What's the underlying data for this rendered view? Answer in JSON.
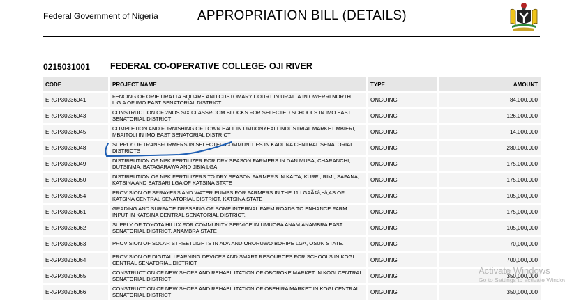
{
  "header": {
    "org": "Federal Government of Nigeria",
    "title": "APPROPRIATION BILL (DETAILS)"
  },
  "section": {
    "code": "0215031001",
    "name": "FEDERAL CO-OPERATIVE COLLEGE- OJI RIVER"
  },
  "table": {
    "columns": {
      "code": "CODE",
      "project": "PROJECT NAME",
      "type": "TYPE",
      "amount": "AMOUNT"
    },
    "rows": [
      {
        "code": "ERGP30236041",
        "project": "FENCING OF ORIE URATTA SQUARE AND CUSTOMARY COURT IN URATTA IN OWERRI NORTH L.G.A OF IMO EAST SENATORIAL DISTRICT",
        "type": "ONGOING",
        "amount": "84,000,000"
      },
      {
        "code": "ERGP30236043",
        "project": "CONSTRUCTION OF 2NOS SIX CLASSROOM BLOCKS FOR SELECTED SCHOOLS IN IMO EAST SENATORIAL DISTRICT",
        "type": "ONGOING",
        "amount": "126,000,000"
      },
      {
        "code": "ERGP30236045",
        "project": "COMPLETION AND FURNISHING OF TOWN HALL IN UMUONYEALI INDUSTRIAL MARKET MBIERI, MBAITOLI IN IMO EAST SENATORIAL DISTRICT",
        "type": "ONGOING",
        "amount": "14,000,000"
      },
      {
        "code": "ERGP30236048",
        "project": "SUPPLY OF TRANSFORMERS IN SELECTED COMMUNITIES IN KADUNA CENTRAL SENATORIAL DISTRICTS",
        "type": "ONGOING",
        "amount": "280,000,000"
      },
      {
        "code": "ERGP30236049",
        "project": "DISTRIBUTION OF NPK FERTILIZER FOR DRY SEASON FARMERS IN DAN MUSA, CHARANCHI, DUTSINMA, BATAGARAWA AND JIBIA LGA",
        "type": "ONGOING",
        "amount": "175,000,000"
      },
      {
        "code": "ERGP30236050",
        "project": "DISTRIBUTION OF NPK FERTILIZERS TO DRY SEASON FARMERS IN KAITA, KURFI, RIMI, SAFANA, KATSINA AND BATSARI LGA OF KATSINA STATE",
        "type": "ONGOING",
        "amount": "175,000,000"
      },
      {
        "code": "ERGP30236054",
        "project": "PROVISION OF SPRAYERS AND WATER PUMPS FOR FARMERS IN THE 11 LGAÃ¢â‚¬â„¢S OF KATSINA CENTRAL SENATORIAL DISTRICT, KATSINA STATE",
        "type": "ONGOING",
        "amount": "105,000,000"
      },
      {
        "code": "ERGP30236061",
        "project": "GRADING AND SURFACE DRESSING OF SOME INTERNAL FARM ROADS TO ENHANCE FARM INPUT IN KATSINA CENTRAL SENATORIAL DISTRICT.",
        "type": "ONGOING",
        "amount": "175,000,000"
      },
      {
        "code": "ERGP30236062",
        "project": "SUPPLY OF TOYOTA HILUX FOR COMMUNITY SERVICE IN UMUOBA ANAM,ANAMBRA EAST SENATORIAL DISTRICT, ANAMBRA STATE",
        "type": "ONGOING",
        "amount": "105,000,000"
      },
      {
        "code": "ERGP30236063",
        "project": "PROVISION OF SOLAR STREETLIGHTS IN ADA AND ORORUWO BORIPE LGA, OSUN STATE.",
        "type": "ONGOING",
        "amount": "70,000,000"
      },
      {
        "code": "ERGP30236064",
        "project": "PROVISION OF DIGITAL LEARNING DEVICES AND SMART RESOURCES FOR SCHOOLS IN KOGI CENTRAL SENATORIAL DISTRICT",
        "type": "ONGOING",
        "amount": "700,000,000"
      },
      {
        "code": "ERGP30236065",
        "project": "CONSTRUCTION OF NEW SHOPS AND REHABILITATION OF OBOROKE MARKET IN KOGI CENTRAL SENATORIAL DISTRICT",
        "type": "ONGOING",
        "amount": "350,000,000"
      },
      {
        "code": "ERGP30236066",
        "project": "CONSTRUCTION OF NEW SHOPS AND REHABILITATION OF OBEHIRA MARKET IN KOGI CENTRAL SENATORIAL DISTRICT",
        "type": "ONGOING",
        "amount": "350,000,000"
      }
    ]
  },
  "overlay": {
    "line1": "Activate Windows",
    "line2": "Go to Settings to activate Windows."
  },
  "colors": {
    "header_fill": "#e6e6e6",
    "row_fill": "#f4f4f4",
    "pen_mark": "#1f5fb4"
  }
}
